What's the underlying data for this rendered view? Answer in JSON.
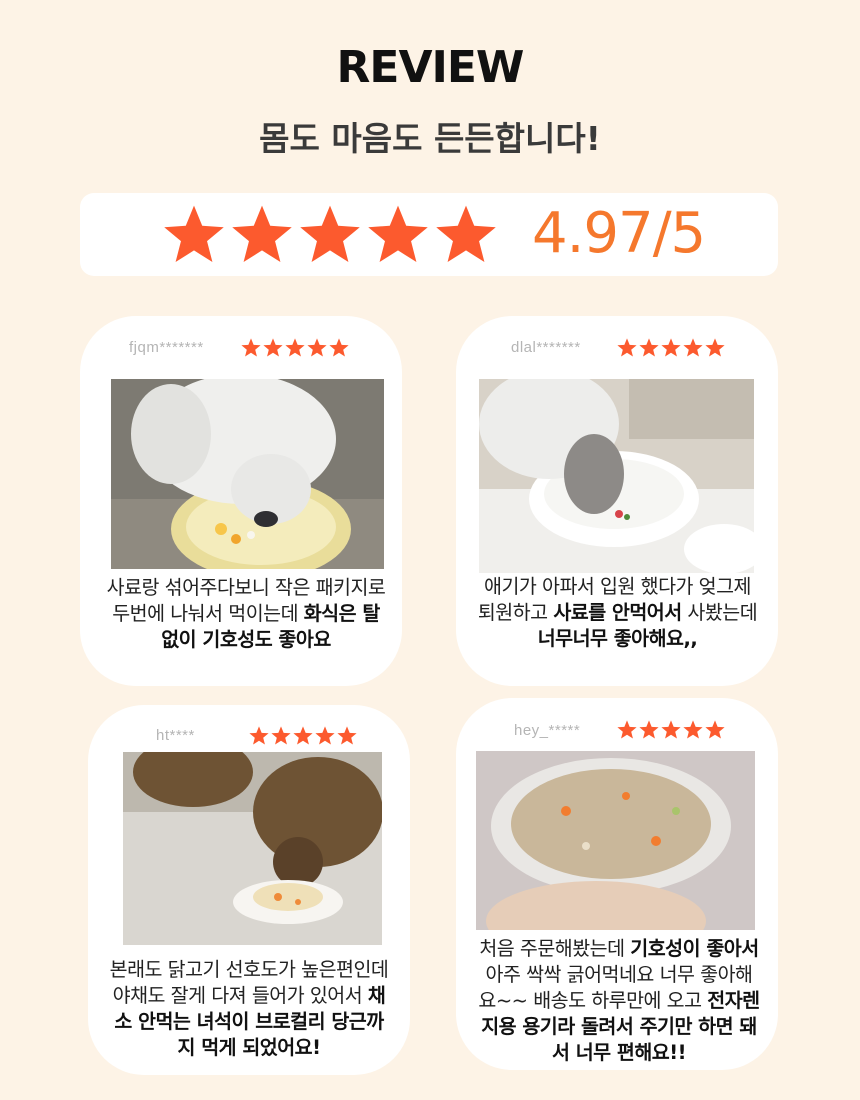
{
  "header": {
    "title": "REVIEW",
    "subtitle": "몸도 마음도 든든합니다!"
  },
  "rating": {
    "score": "4.97/5",
    "stars": 5,
    "star_color": "#fc5a2e",
    "score_color": "#f5782d"
  },
  "reviews": [
    {
      "user": "fjqm*******",
      "stars": 5,
      "photo": "dog-eating-photo",
      "text_1": "사료랑 섞어주다보니 작은 패키지로 두번에 나눠서 먹이는데 ",
      "bold_1": "화식은 탈 없이 기호성도 좋아요",
      "text_2": "",
      "bold_2": "",
      "text_3": ""
    },
    {
      "user": "dlal*******",
      "stars": 5,
      "photo": "dog-bowl-photo",
      "text_1": "애기가 아파서 입원 했다가 엊그제 퇴원하고 ",
      "bold_1": "사료를 안먹어서",
      "text_2": " 사봤는데 ",
      "bold_2": "너무너무 좋아해요,,",
      "text_3": ""
    },
    {
      "user": "ht****",
      "stars": 5,
      "photo": "dog-plate-photo",
      "text_1": "본래도 닭고기 선호도가 높은편인데 야채도 잘게 다져 들어가 있어서 ",
      "bold_1": "채소 안먹는 녀석이 브로컬리 당근까지 먹게 되었어요!",
      "text_2": "",
      "bold_2": "",
      "text_3": ""
    },
    {
      "user": "hey_*****",
      "stars": 5,
      "photo": "food-container-photo",
      "text_1": "처음 주문해봤는데 ",
      "bold_1": "기호성이 좋아서",
      "text_2": " 아주 싹싹 긁어먹네요 너무 좋아해요~~ 배송도 하루만에 오고 ",
      "bold_2": "전자렌지용 용기라 돌려서 주기만 하면 돼서 너무 편해요!!",
      "text_3": ""
    }
  ]
}
